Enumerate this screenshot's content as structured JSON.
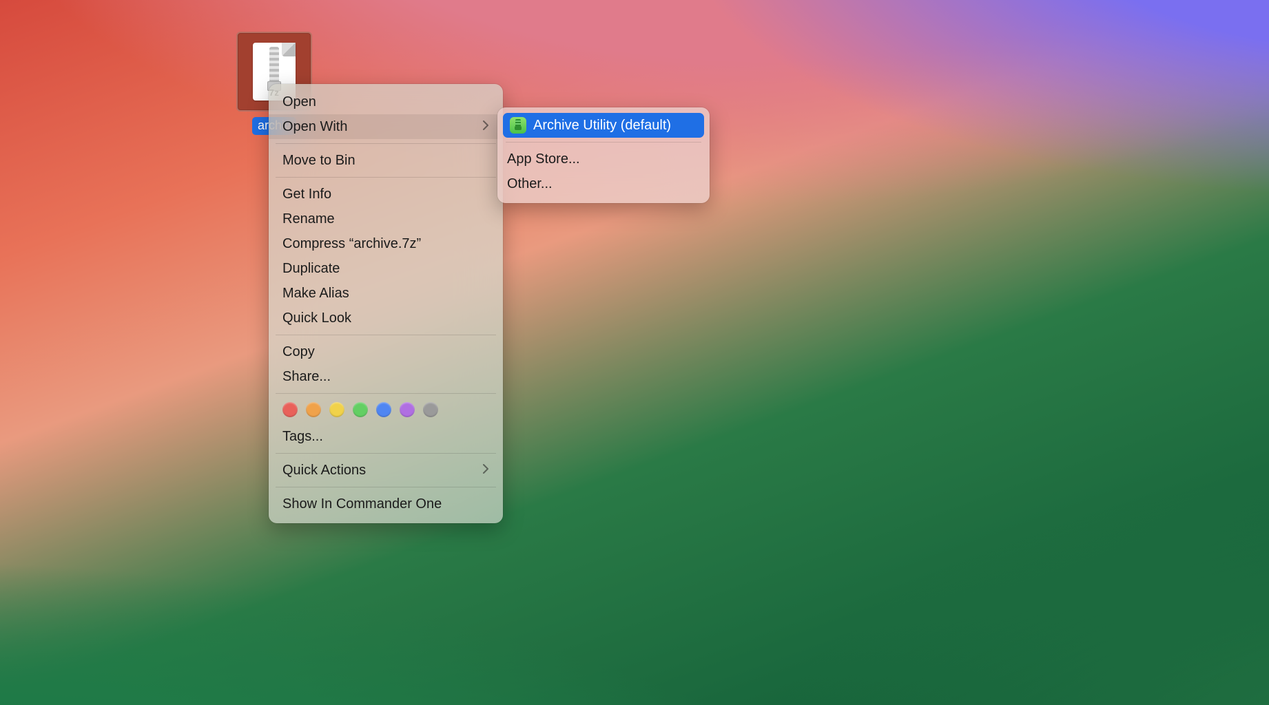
{
  "file": {
    "name_visible": "archiv",
    "ext_label": "7z"
  },
  "context_menu": {
    "open": "Open",
    "open_with": "Open With",
    "move_to_bin": "Move to Bin",
    "get_info": "Get Info",
    "rename": "Rename",
    "compress": "Compress “archive.7z”",
    "duplicate": "Duplicate",
    "make_alias": "Make Alias",
    "quick_look": "Quick Look",
    "copy": "Copy",
    "share": "Share...",
    "tags": "Tags...",
    "quick_actions": "Quick Actions",
    "show_in_commander": "Show In Commander One"
  },
  "tag_colors": [
    "#e9615a",
    "#f0a24a",
    "#f1d24a",
    "#63cf63",
    "#4f86f2",
    "#b06fe2",
    "#9a9a9a"
  ],
  "open_with_menu": {
    "default_app": "Archive Utility (default)",
    "app_store": "App Store...",
    "other": "Other..."
  },
  "colors": {
    "selection_blue": "#1f6fe5"
  }
}
